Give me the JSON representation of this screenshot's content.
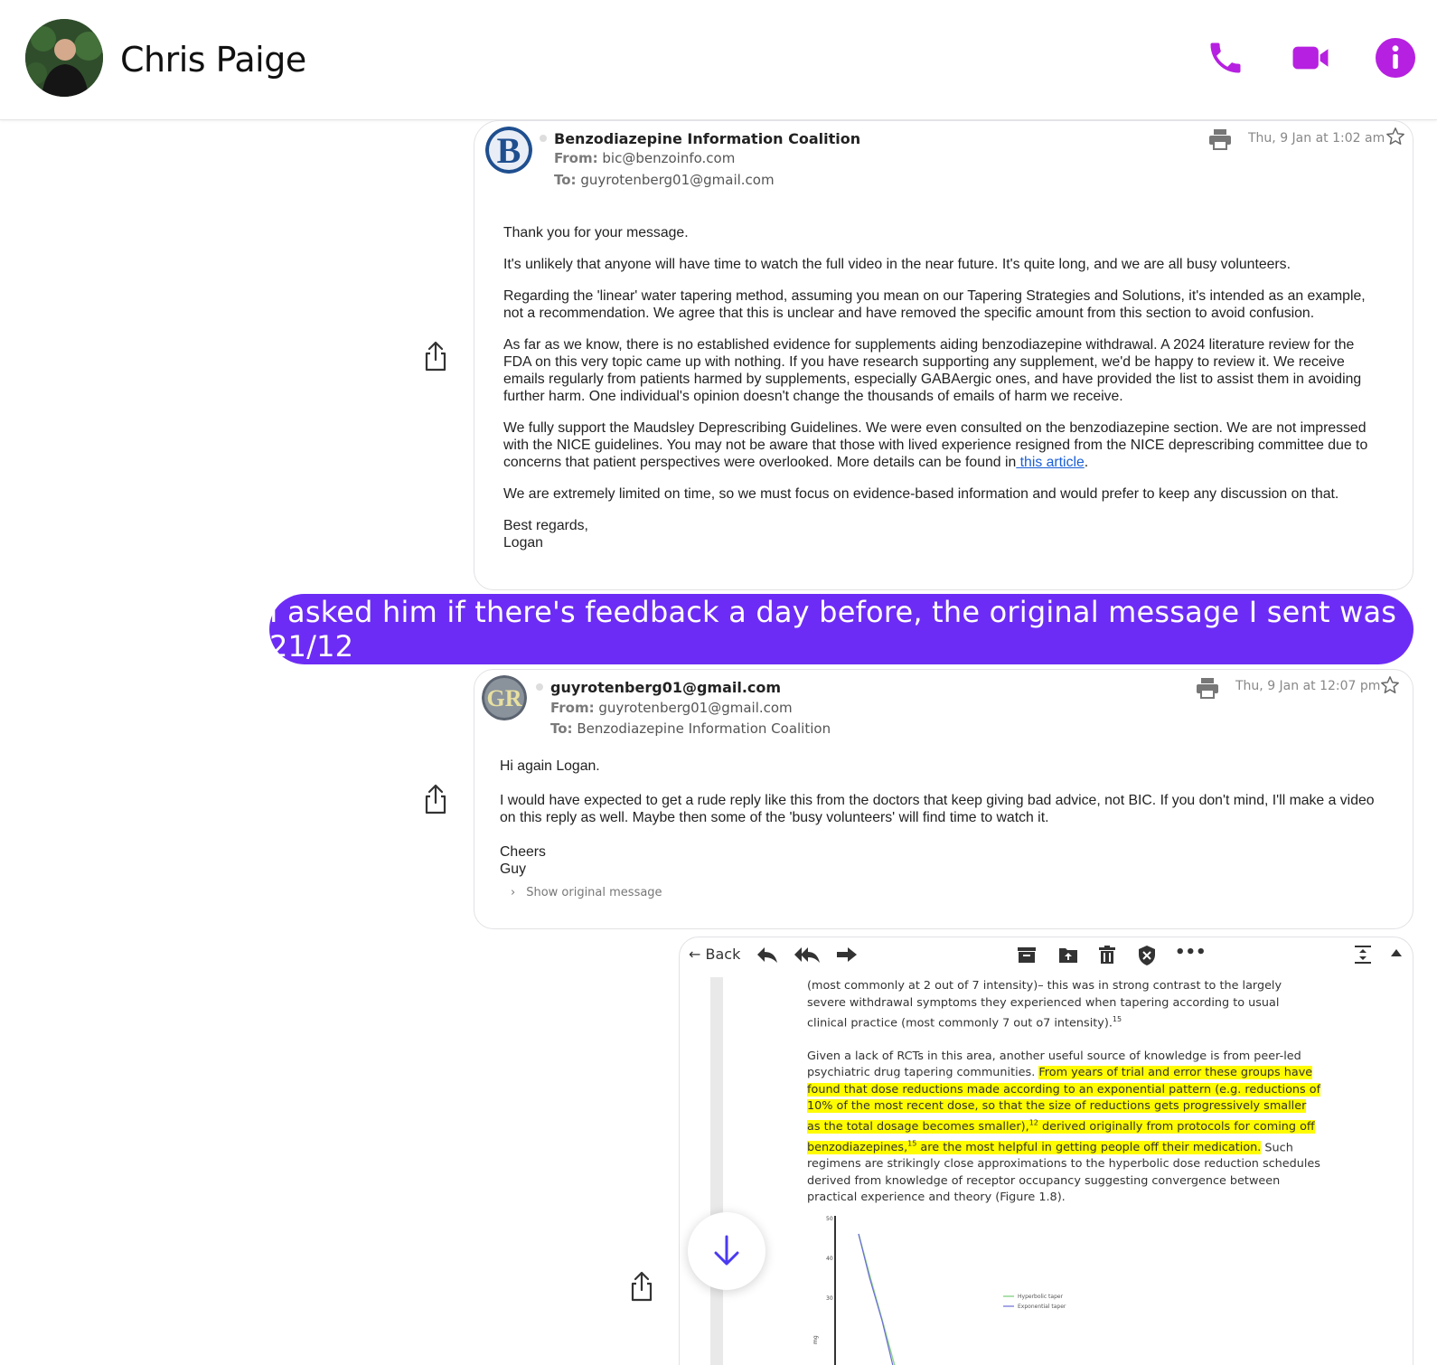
{
  "header": {
    "contact_name": "Chris Paige",
    "icons": [
      "phone-icon",
      "video-icon",
      "info-icon"
    ],
    "accent_color": "#b620e0"
  },
  "email1": {
    "logo_letter": "B",
    "sender": "Benzodiazepine Information Coalition",
    "from_label": "From:",
    "from": "bic@benzoinfo.com",
    "to_label": "To:",
    "to": "guyrotenberg01@gmail.com",
    "date": "Thu, 9 Jan at 1:02 am",
    "body": [
      "Thank you for your message.",
      "It's unlikely that anyone will have time to watch the full video in the near future. It's quite long, and we are all busy volunteers.",
      "Regarding the 'linear' water tapering method, assuming you mean on our Tapering Strategies and Solutions, it's intended as an example, not a recommendation. We agree that this is unclear and have removed the specific amount from this section to avoid confusion.",
      "As far as we know, there is no established evidence for supplements aiding benzodiazepine withdrawal. A 2024 literature review for the FDA on this very topic came up with nothing. If you have research supporting any supplement, we'd be happy to review it. We receive emails regularly from patients harmed by supplements, especially GABAergic ones, and have provided the list to assist them in avoiding further harm. One individual's opinion doesn't change the thousands of emails of harm we receive.",
      "We fully support the Maudsley Deprescribing Guidelines. We were even consulted on the benzodiazepine section. We are not impressed with the NICE guidelines. You may not be aware that those with lived experience resigned from the NICE deprescribing committee due to concerns that patient perspectives were overlooked. More details can be found in",
      "We are extremely limited on time, so we must focus on evidence-based information and would prefer to keep any discussion on that."
    ],
    "link_text": " this article",
    "signoff": "Best regards,",
    "signature": "Logan"
  },
  "bubble": {
    "text": "I asked him if there's feedback a day before, the original message I sent was 21/12",
    "color": "#6d2cf5"
  },
  "email2": {
    "logo_letters": "GR",
    "sender": "guyrotenberg01@gmail.com",
    "from_label": "From:",
    "from": "guyrotenberg01@gmail.com",
    "to_label": "To:",
    "to": "Benzodiazepine Information Coalition",
    "date": "Thu, 9 Jan at 12:07 pm",
    "greeting": "Hi again Logan.",
    "body": "I would have expected to get a rude reply like this from the doctors that keep giving bad advice, not BIC. If you don't mind, I'll make a video on this reply as well. Maybe then some of the 'busy volunteers' will find time to watch it.",
    "signoff": "Cheers",
    "signature": "Guy",
    "show_original": "Show original message"
  },
  "email3": {
    "back_label": "Back",
    "doc_top": "(most commonly at 2 out of 7 intensity)– this was in strong contrast to the largely severe withdrawal symptoms they experienced when tapering according to usual clinical practice (most commonly 7 out o7 intensity).",
    "doc_top_ref": "15",
    "doc_para_start": "Given a lack of RCTs in this area, another useful source of knowledge is from peer-led psychiatric drug tapering communities. ",
    "doc_highlight_1": "From years of trial and error these groups have found that dose reductions made according to an exponential pattern (e.g. reductions of 10% of the most recent dose, so that the size of reductions gets progressively smaller as the total dosage becomes smaller),",
    "doc_ref_1": "12",
    "doc_highlight_2": " derived originally from protocols for coming off benzodiazepines,",
    "doc_ref_2": "15",
    "doc_highlight_3": " are the most helpful in getting people off their medication.",
    "doc_para_end": " Such regimens are strikingly close approximations to the hyperbolic dose reduction schedules derived from knowledge of receptor occupancy suggesting convergence between practical experience and theory (Figure 1.8).",
    "chart_ticks": [
      "50",
      "40",
      "30"
    ],
    "chart_ylabel": "mg",
    "legend": [
      "Hyperbolic taper",
      "Exponential taper"
    ]
  }
}
